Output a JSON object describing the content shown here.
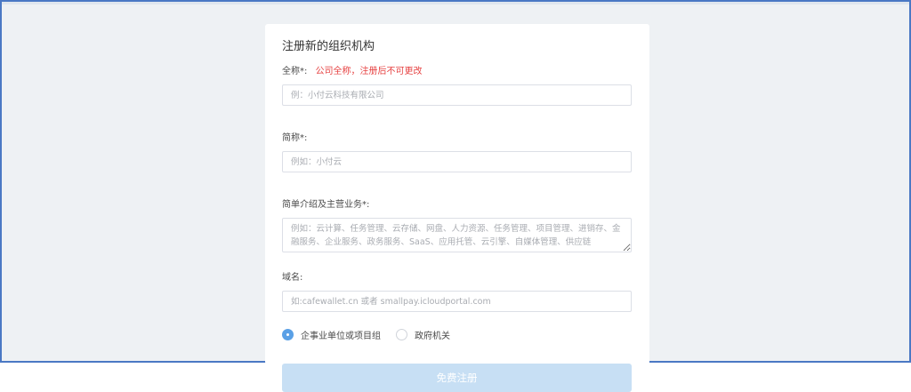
{
  "form": {
    "title": "注册新的组织机构",
    "full_name": {
      "label": "全称*:",
      "hint": "公司全称，注册后不可更改",
      "placeholder": "例：小付云科技有限公司",
      "value": ""
    },
    "short_name": {
      "label": "简称*:",
      "placeholder": "例如：小付云",
      "value": ""
    },
    "description": {
      "label": "简单介绍及主营业务*:",
      "placeholder": "例如：云计算、任务管理、云存储、网盘、人力资源、任务管理、项目管理、进销存、金融服务、企业服务、政务服务、SaaS、应用托管、云引擎、自媒体管理、供应链",
      "value": ""
    },
    "domain": {
      "label": "域名:",
      "placeholder": "如:cafewallet.cn 或者 smallpay.icloudportal.com",
      "value": ""
    },
    "org_type": {
      "options": [
        {
          "label": "企事业单位或项目组",
          "checked": true
        },
        {
          "label": "政府机关",
          "checked": false
        }
      ]
    },
    "submit_label": "免费注册"
  },
  "colors": {
    "accent": "#5aa0e6",
    "submit_disabled": "#c7dff4",
    "hint": "#e64242",
    "background": "#eef1f4"
  }
}
